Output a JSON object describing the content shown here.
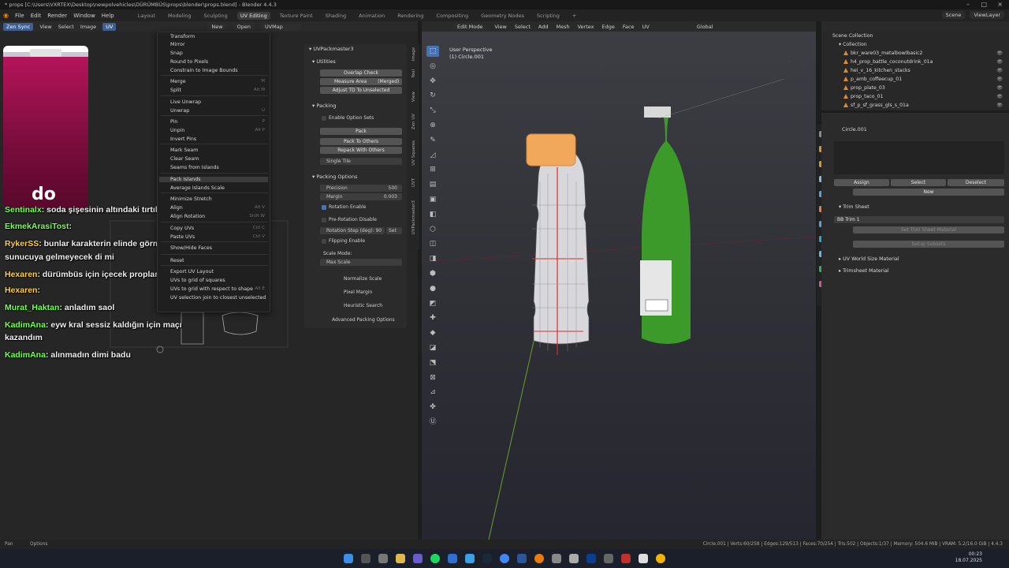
{
  "window": {
    "title": "* props [C:\\Users\\VXRTEX\\Desktop\\newpolvehicles\\DÜRÜMBÜS\\props\\blender\\props.blend] - Blender 4.4.3"
  },
  "topbar": {
    "menus": [
      "File",
      "Edit",
      "Render",
      "Window",
      "Help"
    ],
    "workspaces": [
      "Layout",
      "Modeling",
      "Sculpting",
      "UV Editing",
      "Texture Paint",
      "Shading",
      "Animation",
      "Rendering",
      "Compositing",
      "Geometry Nodes",
      "Scripting"
    ],
    "active_workspace": "UV Editing",
    "scene": "Scene",
    "view_layer": "ViewLayer"
  },
  "uv_header": {
    "sync": "Zen Sync",
    "menus": [
      "View",
      "Select",
      "Image",
      "UV"
    ],
    "new": "New",
    "open": "Open",
    "uvmap": "UVMap"
  },
  "uv_menu": {
    "items": [
      {
        "label": "Transform",
        "sc": ""
      },
      {
        "label": "Mirror",
        "sc": ""
      },
      {
        "label": "Snap",
        "sc": ""
      },
      {
        "label": "Round to Pixels",
        "sc": ""
      },
      {
        "label": "Constrain to Image Bounds",
        "sc": ""
      },
      {
        "label": "Merge",
        "sc": "M"
      },
      {
        "label": "Split",
        "sc": "Alt M"
      },
      {
        "label": "Live Unwrap",
        "sc": ""
      },
      {
        "label": "Unwrap",
        "sc": "U"
      },
      {
        "label": "Pin",
        "sc": "P"
      },
      {
        "label": "Unpin",
        "sc": "Alt P"
      },
      {
        "label": "Invert Pins",
        "sc": ""
      },
      {
        "label": "Mark Seam",
        "sc": ""
      },
      {
        "label": "Clear Seam",
        "sc": ""
      },
      {
        "label": "Seams from Islands",
        "sc": ""
      },
      {
        "label": "Pack Islands",
        "sc": ""
      },
      {
        "label": "Average Islands Scale",
        "sc": ""
      },
      {
        "label": "Minimize Stretch",
        "sc": ""
      },
      {
        "label": "Align",
        "sc": "Alt V"
      },
      {
        "label": "Align Rotation",
        "sc": "Shift W"
      },
      {
        "label": "Copy UVs",
        "sc": "Ctrl C"
      },
      {
        "label": "Paste UVs",
        "sc": "Ctrl V"
      },
      {
        "label": "Show/Hide Faces",
        "sc": ""
      },
      {
        "label": "Reset",
        "sc": ""
      },
      {
        "label": "Export UV Layout",
        "sc": ""
      },
      {
        "label": "UVs to grid of squares",
        "sc": ""
      },
      {
        "label": "UVs to grid with respect to shape",
        "sc": "Alt E"
      },
      {
        "label": "UV selection join to closest unselected",
        "sc": ""
      }
    ]
  },
  "chat": [
    {
      "name": "Sentinalx",
      "msg": ": soda şişesinin altındaki tırtıklar yok"
    },
    {
      "name": "EkmekArasiTost",
      "msg": ":"
    },
    {
      "name": "RykerSS",
      "msg": ": bunlar karakterin elinde görmeden"
    },
    {
      "name": "",
      "msg": "sunucuya gelmeyecek di mi"
    },
    {
      "name": "Hexaren",
      "msg": ": dürümbüs için içecek propları"
    },
    {
      "name": "Hexaren",
      "msg": ":"
    },
    {
      "name": "Murat_Haktan",
      "msg": ": anladım saol"
    },
    {
      "name": "KadimAna",
      "msg": ": eyw kral sessiz kaldığın için maçı"
    },
    {
      "name": "",
      "msg": "kazandım"
    },
    {
      "name": "KadimAna",
      "msg": ": alınmadın dimi badu"
    }
  ],
  "bottle_label": "do",
  "uvpacker": {
    "title": "UVPackmaster3",
    "utilities": "Utilities",
    "overlap": "Overlap Check",
    "measure": "Measure Area",
    "merged": "(Merged)",
    "adjust": "Adjust TD To Unselected",
    "packing": "Packing",
    "enable_sets": "Enable Option Sets",
    "pack": "Pack",
    "pack_others": "Pack To Others",
    "repack": "Repack With Others",
    "single_tile": "Single Tile",
    "packing_options": "Packing Options",
    "precision_label": "Precision",
    "precision_val": "500",
    "margin_label": "Margin",
    "margin_val": "0.003",
    "rotation_enable": "Rotation Enable",
    "pre_rotation": "Pre-Rotation Disable",
    "rotation_step": "Rotation Step (deg): 90",
    "set": "Set",
    "flipping": "Flipping Enable",
    "scale_mode": "Scale Mode:",
    "max_scale": "Max Scale",
    "normalize": "Normalize Scale",
    "pixel_margin": "Pixel Margin",
    "heuristic": "Heuristic Search",
    "advanced": "Advanced Packing Options"
  },
  "side_tabs": [
    "Image",
    "Tool",
    "View",
    "Zen UV",
    "UV Squares",
    "UVT",
    "UVPackmaster3"
  ],
  "viewport_header": {
    "mode": "Edit Mode",
    "menus": [
      "View",
      "Select",
      "Add",
      "Mesh",
      "Vertex",
      "Edge",
      "Face",
      "UV"
    ],
    "orientation": "Global",
    "options": "Options"
  },
  "viewport_info": {
    "line1": "User Perspective",
    "line2": "(1) Circle.001"
  },
  "outliner": {
    "root": "Scene Collection",
    "collection": "Collection",
    "items": [
      "bkr_ware03_metalbowlbasic2",
      "h4_prop_battle_coconutdrink_01a",
      "hei_v_16_kitchen_stacks",
      "p_amb_coffeecup_01",
      "prop_plate_03",
      "prop_taco_01",
      "sf_p_sf_grass_gls_s_01a"
    ]
  },
  "properties": {
    "object": "Circle.001",
    "assign": "Assign",
    "select": "Select",
    "deselect": "Deselect",
    "new": "New",
    "trim_sheet": "Trim Sheet",
    "bb_trim": "BB Trim 1",
    "set_material": "Set Trim Sheet Material",
    "setup_subsets": "Setup Subsets",
    "uv_world": "UV World Size Material",
    "trimsheet_material": "Trimsheet Material"
  },
  "status": {
    "pan": "Pan",
    "options": "Options",
    "stats": "Circle.001 | Verts:60/258 | Edges:129/513 | Faces:70/254 | Tris:502 | Objects:1/37 | Memory: 504.6 MiB | VRAM: 5.2/16.0 GiB | 4.4.3"
  },
  "taskbar": {
    "time": "00:23",
    "date": "18.07.2025"
  },
  "colors": {
    "accent": "#4772b3",
    "chat_name": "#77ff55",
    "chat_name_alt": "#ffcf4d",
    "bottle_green": "#3c9a2a",
    "bottle_cap": "#f2a85a",
    "seam_red": "#d23030"
  }
}
